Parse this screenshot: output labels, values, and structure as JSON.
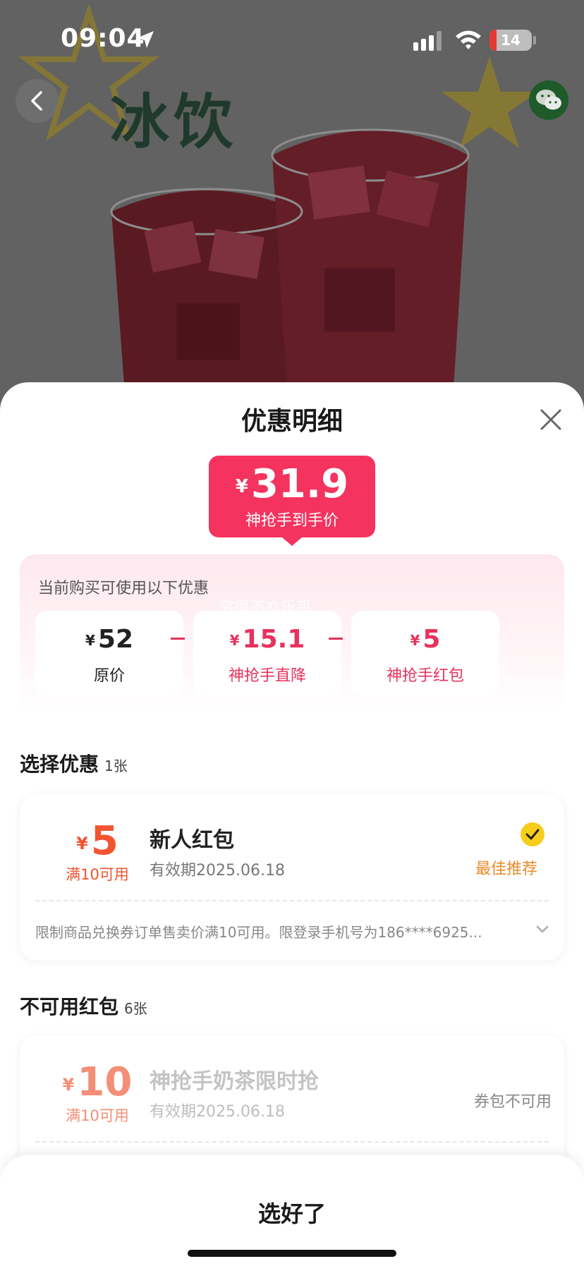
{
  "status_bar": {
    "time": "09:04",
    "battery": "14"
  },
  "banner": {
    "promo_text": "冰饮"
  },
  "sheet": {
    "title": "优惠明细",
    "final_price": {
      "currency": "¥",
      "value": "31.9",
      "caption": "神抢手到手价"
    },
    "breakdown": {
      "label": "当前购买可使用以下优惠",
      "watermark": "穷得不亦乐乎",
      "items": [
        {
          "currency": "¥",
          "amount": "52",
          "label": "原价"
        },
        {
          "currency": "¥",
          "amount": "15.1",
          "label": "神抢手直降"
        },
        {
          "currency": "¥",
          "amount": "5",
          "label": "神抢手红包"
        }
      ]
    }
  },
  "select_section": {
    "title": "选择优惠",
    "count": "1张",
    "coupon": {
      "currency": "¥",
      "amount": "5",
      "condition": "满10可用",
      "name": "新人红包",
      "expiry": "有效期2025.06.18",
      "badge": "最佳推荐",
      "limit": "限制商品兑换券订单售卖价满10可用。限登录手机号为186****6925..."
    }
  },
  "unavailable_section": {
    "title": "不可用红包",
    "count": "6张",
    "coupon": {
      "currency": "¥",
      "amount": "10",
      "condition": "满10可用",
      "name": "神抢手奶茶限时抢",
      "expiry": "有效期2025.06.18",
      "status": "券包不可用"
    }
  },
  "footer": {
    "confirm_label": "选好了"
  },
  "colors": {
    "accent_pink": "#f5335f",
    "coupon_orange": "#f25430",
    "badge_orange": "#ea8a2a",
    "check_yellow": "#f7cd1c"
  },
  "icons": {
    "back": "chevron-left-icon",
    "share": "wechat-icon",
    "close": "close-icon",
    "selected": "check-icon",
    "expand": "chevron-down-icon"
  }
}
